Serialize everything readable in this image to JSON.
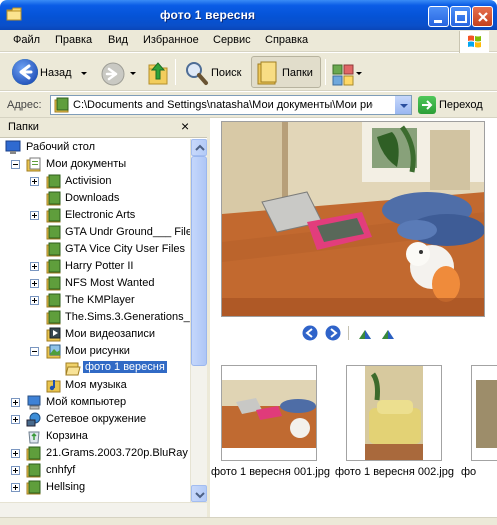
{
  "window": {
    "title": "фото 1 вересня"
  },
  "menu": [
    "Файл",
    "Правка",
    "Вид",
    "Избранное",
    "Сервис",
    "Справка"
  ],
  "toolbar": {
    "back_label": "Назад",
    "search_label": "Поиск",
    "folders_label": "Папки"
  },
  "address": {
    "label": "Адрес:",
    "value": "C:\\Documents and Settings\\natasha\\Мои документы\\Мои рисунки",
    "go_label": "Переход"
  },
  "folder_pane": {
    "title": "Папки",
    "close_glyph": "×",
    "items": [
      {
        "label": "Рабочий стол",
        "expander": "none",
        "icon": "desktop-icon"
      },
      {
        "label": "Мои документы",
        "expander": "minus",
        "icon": "my-documents-icon"
      },
      {
        "label": "Activision",
        "expander": "plus",
        "icon": "folder-icon"
      },
      {
        "label": "Downloads",
        "expander": "none",
        "icon": "folder-icon"
      },
      {
        "label": "Electronic Arts",
        "expander": "plus",
        "icon": "folder-icon"
      },
      {
        "label": "GTA Undr Ground___ File",
        "expander": "none",
        "icon": "folder-icon"
      },
      {
        "label": "GTA Vice City User Files",
        "expander": "none",
        "icon": "folder-icon"
      },
      {
        "label": "Harry Potter II",
        "expander": "plus",
        "icon": "folder-icon"
      },
      {
        "label": "NFS Most Wanted",
        "expander": "plus",
        "icon": "folder-icon"
      },
      {
        "label": "The KMPlayer",
        "expander": "plus",
        "icon": "folder-icon"
      },
      {
        "label": "The.Sims.3.Generations_",
        "expander": "none",
        "icon": "folder-icon"
      },
      {
        "label": "Мои видеозаписи",
        "expander": "none",
        "icon": "my-videos-icon"
      },
      {
        "label": "Мои рисунки",
        "expander": "minus",
        "icon": "my-pictures-icon"
      },
      {
        "label": "фото 1 вересня",
        "expander": "none",
        "icon": "open-folder-icon"
      },
      {
        "label": "Моя музыка",
        "expander": "none",
        "icon": "my-music-icon"
      },
      {
        "label": "Мой компьютер",
        "expander": "plus",
        "icon": "my-computer-icon"
      },
      {
        "label": "Сетевое окружение",
        "expander": "plus",
        "icon": "network-icon"
      },
      {
        "label": "Корзина",
        "expander": "none",
        "icon": "recycle-bin-icon"
      },
      {
        "label": "21.Grams.2003.720p.BluRay",
        "expander": "plus",
        "icon": "folder-icon"
      },
      {
        "label": "cnhfyf",
        "expander": "plus",
        "icon": "folder-icon"
      },
      {
        "label": "Hellsing",
        "expander": "plus",
        "icon": "folder-icon"
      }
    ]
  },
  "preview": {
    "image_description": "room-with-cushions-and-toy-dog-photo"
  },
  "thumbnails": [
    {
      "caption": "фото 1 вересня 001.jpg"
    },
    {
      "caption": "фото 1 вересня 002.jpg"
    },
    {
      "caption": "фо"
    }
  ],
  "colors": {
    "title_blue": "#0553d6",
    "chrome": "#ece9d8",
    "selection": "#316ac5"
  }
}
